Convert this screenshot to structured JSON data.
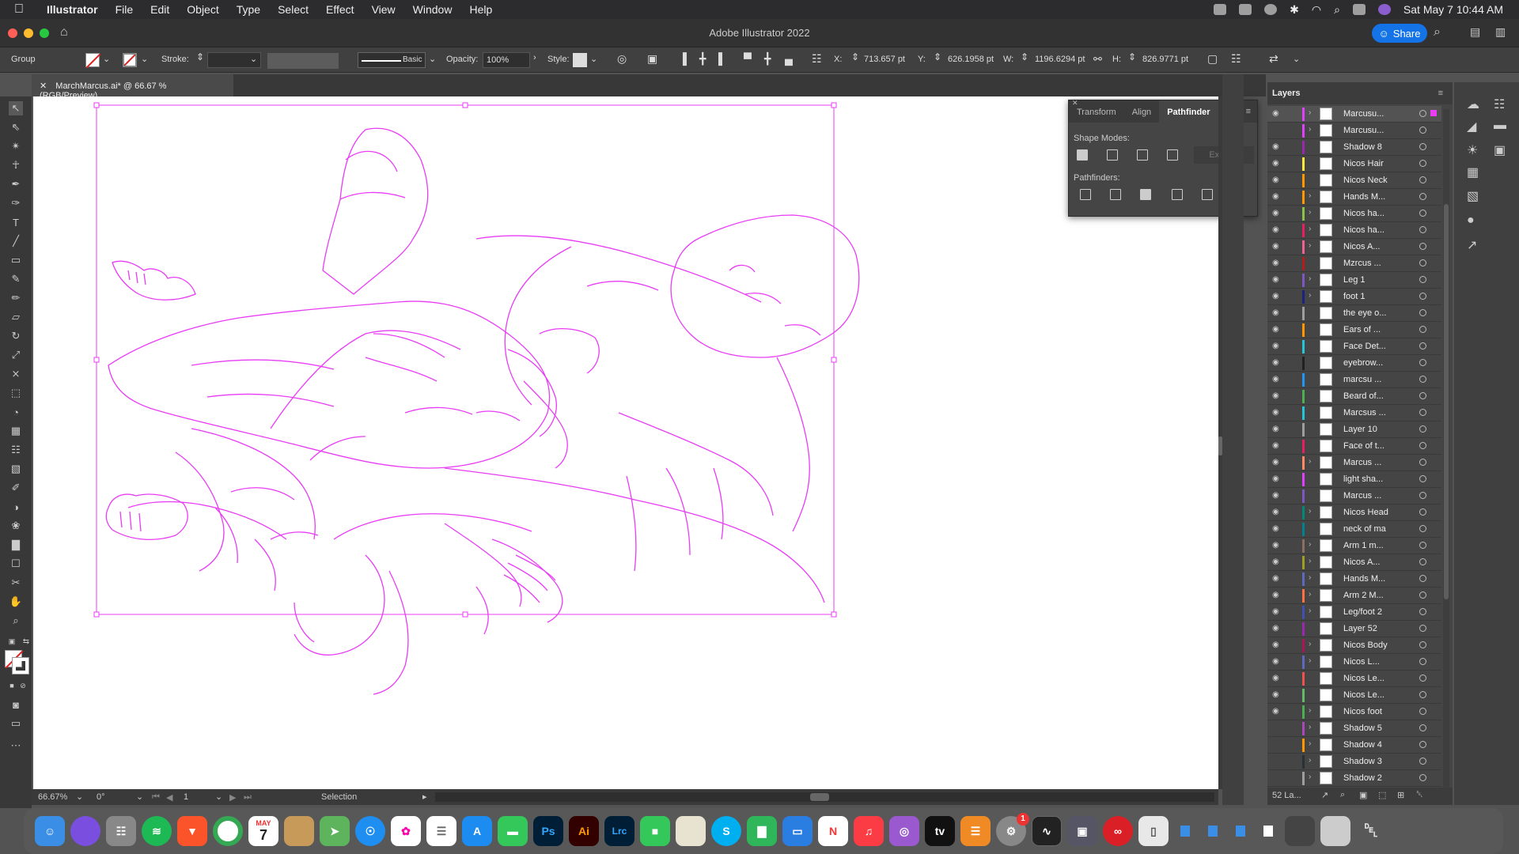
{
  "menubar": {
    "app": "Illustrator",
    "items": [
      "File",
      "Edit",
      "Object",
      "Type",
      "Select",
      "Effect",
      "View",
      "Window",
      "Help"
    ],
    "clock": "Sat May 7  10:44 AM"
  },
  "window": {
    "title": "Adobe Illustrator 2022",
    "share_label": "Share"
  },
  "control_bar": {
    "selection_type": "Group",
    "stroke_label": "Stroke:",
    "brush_label": "Basic",
    "opacity_label": "Opacity:",
    "opacity_value": "100%",
    "style_label": "Style:",
    "x_label": "X:",
    "x_value": "713.657 pt",
    "y_label": "Y:",
    "y_value": "626.1958 pt",
    "w_label": "W:",
    "w_value": "1196.6294 pt",
    "h_label": "H:",
    "h_value": "826.9771 pt"
  },
  "document_tab": {
    "label": "MarchMarcus.ai* @ 66.67 % (RGB/Preview)"
  },
  "pathfinder_panel": {
    "tabs": [
      "Transform",
      "Align",
      "Pathfinder"
    ],
    "active_tab": "Pathfinder",
    "shape_modes_label": "Shape Modes:",
    "pathfinders_label": "Pathfinders:",
    "expand_label": "Expand"
  },
  "layers_panel": {
    "title": "Layers",
    "footer_count": "52 La...",
    "layers": [
      {
        "name": "Marcusu...",
        "color": "#e040fb",
        "expandable": true,
        "eye": true,
        "selected": true
      },
      {
        "name": "Marcusu...",
        "color": "#e040fb",
        "expandable": true,
        "eye": false
      },
      {
        "name": "Shadow 8",
        "color": "#9c27b0",
        "expandable": false,
        "eye": true
      },
      {
        "name": "Nicos Hair",
        "color": "#ffeb3b",
        "expandable": false,
        "eye": true
      },
      {
        "name": "Nicos Neck",
        "color": "#ff9800",
        "expandable": false,
        "eye": true
      },
      {
        "name": "Hands M...",
        "color": "#ff9800",
        "expandable": true,
        "eye": true
      },
      {
        "name": "Nicos ha...",
        "color": "#8bc34a",
        "expandable": true,
        "eye": true
      },
      {
        "name": "Nicos ha...",
        "color": "#e91e63",
        "expandable": true,
        "eye": true
      },
      {
        "name": "Nicos A...",
        "color": "#f06292",
        "expandable": true,
        "eye": true
      },
      {
        "name": "Mzrcus ...",
        "color": "#b71c1c",
        "expandable": false,
        "eye": true
      },
      {
        "name": "Leg 1",
        "color": "#7e57c2",
        "expandable": true,
        "eye": true
      },
      {
        "name": "foot 1",
        "color": "#1a237e",
        "expandable": true,
        "eye": true
      },
      {
        "name": "the eye o...",
        "color": "#9e9e9e",
        "expandable": false,
        "eye": true
      },
      {
        "name": "Ears of ...",
        "color": "#ff9800",
        "expandable": false,
        "eye": true
      },
      {
        "name": "Face Det...",
        "color": "#26c6da",
        "expandable": false,
        "eye": true
      },
      {
        "name": "eyebrow...",
        "color": "#212121",
        "expandable": false,
        "eye": true
      },
      {
        "name": "marcsu ...",
        "color": "#2196f3",
        "expandable": false,
        "eye": true
      },
      {
        "name": "Beard of...",
        "color": "#4caf50",
        "expandable": false,
        "eye": true
      },
      {
        "name": "Marcsus ...",
        "color": "#26c6da",
        "expandable": false,
        "eye": true
      },
      {
        "name": "Layer 10",
        "color": "#9e9e9e",
        "expandable": false,
        "eye": true
      },
      {
        "name": "Face of t...",
        "color": "#e91e63",
        "expandable": false,
        "eye": true
      },
      {
        "name": "Marcus ...",
        "color": "#ff8a65",
        "expandable": true,
        "eye": true
      },
      {
        "name": "light sha...",
        "color": "#e040fb",
        "expandable": false,
        "eye": true
      },
      {
        "name": "Marcus ...",
        "color": "#7e57c2",
        "expandable": false,
        "eye": true
      },
      {
        "name": "Nicos Head",
        "color": "#00897b",
        "expandable": true,
        "eye": true
      },
      {
        "name": "neck of ma",
        "color": "#00838f",
        "expandable": false,
        "eye": true
      },
      {
        "name": "Arm 1 m...",
        "color": "#8d6e63",
        "expandable": true,
        "eye": true
      },
      {
        "name": "Nicos A...",
        "color": "#9e9d24",
        "expandable": true,
        "eye": true
      },
      {
        "name": "Hands M...",
        "color": "#5c6bc0",
        "expandable": true,
        "eye": true
      },
      {
        "name": "Arm 2 M...",
        "color": "#ff7043",
        "expandable": true,
        "eye": true
      },
      {
        "name": "Leg/foot 2",
        "color": "#3f51b5",
        "expandable": true,
        "eye": true
      },
      {
        "name": "Layer 52",
        "color": "#9c27b0",
        "expandable": false,
        "eye": true
      },
      {
        "name": "Nicos Body",
        "color": "#ad1457",
        "expandable": true,
        "eye": true
      },
      {
        "name": "Nicos L...",
        "color": "#5c6bc0",
        "expandable": true,
        "eye": true
      },
      {
        "name": "Nicos Le...",
        "color": "#ef5350",
        "expandable": false,
        "eye": true
      },
      {
        "name": "Nicos Le...",
        "color": "#66bb6a",
        "expandable": false,
        "eye": true
      },
      {
        "name": "Nicos foot",
        "color": "#4caf50",
        "expandable": true,
        "eye": true
      },
      {
        "name": "Shadow 5",
        "color": "#ab47bc",
        "expandable": true,
        "eye": false
      },
      {
        "name": "Shadow 4",
        "color": "#ff9800",
        "expandable": true,
        "eye": false
      },
      {
        "name": "Shadow 3",
        "color": "#263238",
        "expandable": true,
        "eye": false
      },
      {
        "name": "Shadow 2",
        "color": "#9e9e9e",
        "expandable": true,
        "eye": false
      }
    ]
  },
  "status_bar": {
    "zoom": "66.67%",
    "rotation": "0°",
    "artboard_number": "1",
    "tool": "Selection"
  },
  "colors": {
    "selection": "#e83cf5",
    "accent": "#1473e6"
  },
  "dock": {
    "calendar_day": "7",
    "calendar_month": "MAY",
    "settings_badge": "1",
    "apps": [
      "finder-icon",
      "siri-icon",
      "launchpad-icon",
      "spotify-icon",
      "brave-icon",
      "chrome-icon",
      "calendar-icon",
      "notes-icon",
      "maps-icon",
      "safari-icon",
      "photos-icon",
      "reminders-icon",
      "appstore-icon",
      "messages-icon",
      "photoshop-icon",
      "illustrator-icon",
      "lightroom-classic-icon",
      "facetime-icon",
      "preview-icon",
      "skype-icon",
      "numbers-icon",
      "keynote-icon",
      "news-icon",
      "music-icon",
      "podcasts-icon",
      "appletv-icon",
      "books-icon",
      "system-preferences-icon",
      "activity-monitor-icon",
      "screenshot-icon",
      "creative-cloud-icon",
      "finder-doc-icon",
      "trash-icon"
    ],
    "labels": {
      "photoshop": "Ps",
      "illustrator": "Ai",
      "lightroom": "Lrc",
      "skype": "S",
      "tv": "tv"
    }
  }
}
